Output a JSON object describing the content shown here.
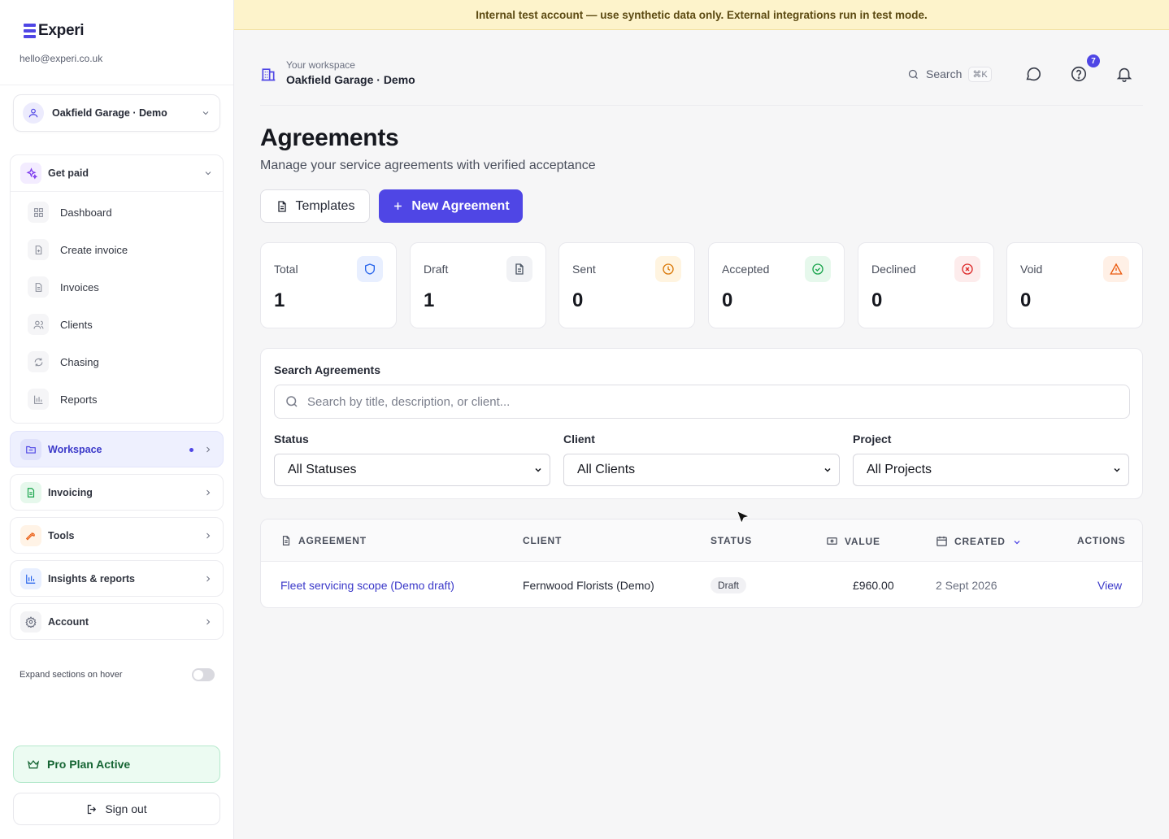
{
  "brand": {
    "name": "Experi",
    "email": "hello@experi.co.uk"
  },
  "banner": {
    "text": "Internal test account — use synthetic data only. External integrations run in test mode."
  },
  "sidebar": {
    "workspace_select": "Oakfield Garage · Demo",
    "get_paid": {
      "label": "Get paid",
      "items": [
        {
          "label": "Dashboard",
          "icon": "grid-icon"
        },
        {
          "label": "Create invoice",
          "icon": "file-plus-icon"
        },
        {
          "label": "Invoices",
          "icon": "file-text-icon"
        },
        {
          "label": "Clients",
          "icon": "users-icon"
        },
        {
          "label": "Chasing",
          "icon": "refresh-icon"
        },
        {
          "label": "Reports",
          "icon": "bar-chart-icon"
        }
      ]
    },
    "sections": [
      {
        "label": "Workspace",
        "icon": "folder-icon"
      },
      {
        "label": "Invoicing",
        "icon": "invoice-icon"
      },
      {
        "label": "Tools",
        "icon": "wrench-icon"
      },
      {
        "label": "Insights & reports",
        "icon": "chart-icon"
      },
      {
        "label": "Account",
        "icon": "settings-icon"
      }
    ],
    "expand_hover_label": "Expand sections on hover",
    "expand_hover_on": false,
    "pro_plan": "Pro Plan Active",
    "sign_out": "Sign out"
  },
  "header": {
    "workspace_caption": "Your workspace",
    "workspace_name": "Oakfield Garage · Demo",
    "search_label": "Search",
    "search_shortcut": "⌘K",
    "help_badge": "7"
  },
  "page": {
    "title": "Agreements",
    "subtitle": "Manage your service agreements with verified acceptance",
    "templates_button": "Templates",
    "new_button": "New Agreement"
  },
  "stats": [
    {
      "label": "Total",
      "value": "1",
      "icon": "shield-icon",
      "color": "#2563eb",
      "bg": "#e8efff"
    },
    {
      "label": "Draft",
      "value": "1",
      "icon": "document-icon",
      "color": "#4b5563",
      "bg": "#f1f2f5"
    },
    {
      "label": "Sent",
      "value": "0",
      "icon": "clock-icon",
      "color": "#d97706",
      "bg": "#fff4e0"
    },
    {
      "label": "Accepted",
      "value": "0",
      "icon": "check-circle-icon",
      "color": "#16a34a",
      "bg": "#e6f8ec"
    },
    {
      "label": "Declined",
      "value": "0",
      "icon": "x-circle-icon",
      "color": "#dc2626",
      "bg": "#fdecec"
    },
    {
      "label": "Void",
      "value": "0",
      "icon": "warning-icon",
      "color": "#ea580c",
      "bg": "#fff0e6"
    }
  ],
  "search": {
    "title": "Search Agreements",
    "placeholder": "Search by title, description, or client...",
    "filters": [
      {
        "label": "Status",
        "value": "All Statuses"
      },
      {
        "label": "Client",
        "value": "All Clients"
      },
      {
        "label": "Project",
        "value": "All Projects"
      }
    ]
  },
  "table": {
    "headers": {
      "agreement": "AGREEMENT",
      "client": "CLIENT",
      "status": "STATUS",
      "value": "VALUE",
      "created": "CREATED",
      "actions": "ACTIONS"
    },
    "rows": [
      {
        "agreement": "Fleet servicing scope (Demo draft)",
        "client": "Fernwood Florists (Demo)",
        "status": "Draft",
        "value": "£960.00",
        "created": "2 Sept 2026",
        "action": "View"
      }
    ]
  },
  "colors": {
    "accent": "#4f46e5",
    "banner_bg": "#fdf3cb",
    "pro_bg": "#ecfbf2"
  }
}
